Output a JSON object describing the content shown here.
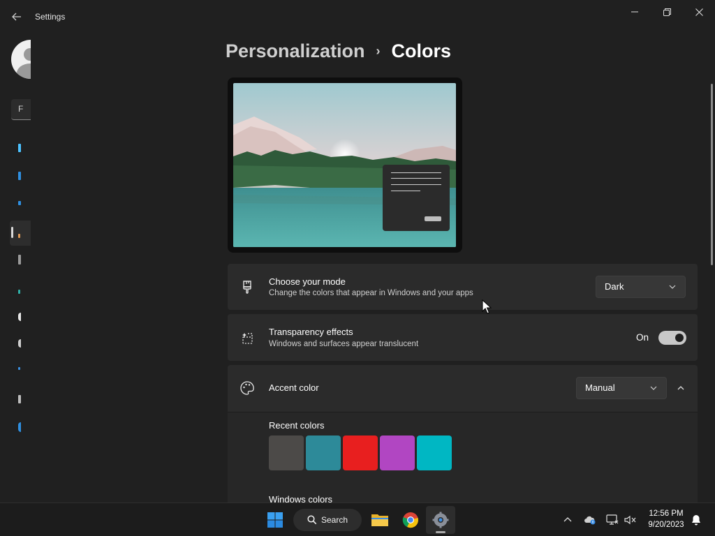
{
  "window": {
    "title": "Settings"
  },
  "sidebar": {
    "find_text": "F"
  },
  "breadcrumb": {
    "parent": "Personalization",
    "separator": "›",
    "current": "Colors"
  },
  "mode_card": {
    "title": "Choose your mode",
    "subtitle": "Change the colors that appear in Windows and your apps",
    "value": "Dark"
  },
  "transparency_card": {
    "title": "Transparency effects",
    "subtitle": "Windows and surfaces appear translucent",
    "state_label": "On",
    "enabled": true
  },
  "accent_card": {
    "title": "Accent color",
    "value": "Manual",
    "expanded": true
  },
  "recent_colors": {
    "label": "Recent colors",
    "swatches": [
      "#4c4a48",
      "#2d8a99",
      "#e81f1f",
      "#b146c2",
      "#00b7c3"
    ]
  },
  "windows_colors": {
    "label": "Windows colors"
  },
  "taskbar": {
    "search_label": "Search",
    "time": "12:56 PM",
    "date": "9/20/2023"
  },
  "colors": {
    "background": "#202020",
    "card": "#2b2b2b",
    "taskbar": "#1c1c1c"
  }
}
